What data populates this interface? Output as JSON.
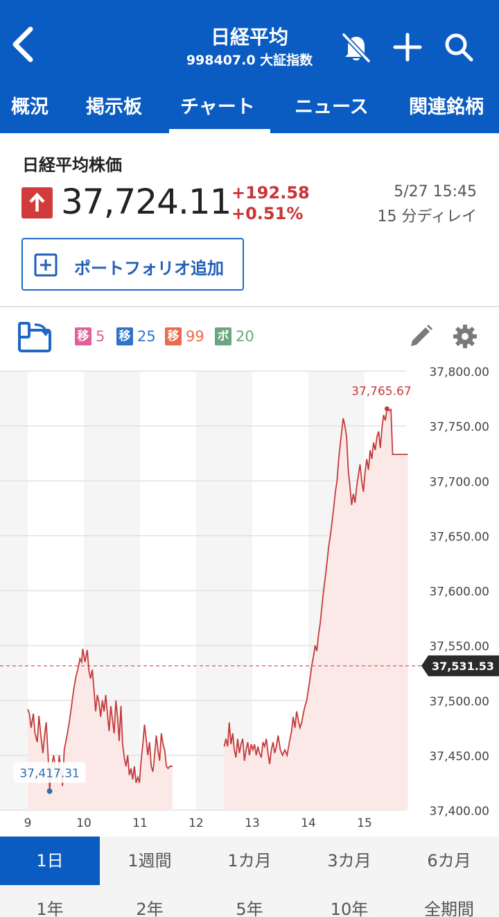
{
  "header": {
    "title": "日経平均",
    "subtitle": "998407.0 大証指数",
    "tabs": [
      "概況",
      "掲示板",
      "チャート",
      "ニュース",
      "関連銘柄"
    ],
    "active_tab": "チャート"
  },
  "quote": {
    "name": "日経平均株価",
    "price": "37,724.11",
    "change": "+192.58",
    "change_pct": "+0.51%",
    "datetime": "5/27 15:45",
    "delay": "15 分ディレイ",
    "portfolio_button": "ポートフォリオ追加"
  },
  "indicators": [
    {
      "badge": "移",
      "value": "5",
      "color": "#e2609a"
    },
    {
      "badge": "移",
      "value": "25",
      "color": "#2f74c8"
    },
    {
      "badge": "移",
      "value": "99",
      "color": "#ec6a4c"
    },
    {
      "badge": "ボ",
      "value": "20",
      "color": "#6aa680"
    }
  ],
  "chart_data": {
    "type": "line",
    "x_ticks": [
      "9",
      "10",
      "11",
      "12",
      "13",
      "14",
      "15"
    ],
    "y_ticks": [
      "37,800.00",
      "37,750.00",
      "37,700.00",
      "37,650.00",
      "37,600.00",
      "37,550.00",
      "37,500.00",
      "37,450.00",
      "37,400.00"
    ],
    "ylim": [
      37400,
      37800
    ],
    "xlim": [
      9,
      16
    ],
    "prev_close": 37531.53,
    "prev_close_label": "37,531.53",
    "high_label": "37,765.67",
    "low_label": "37,417.31",
    "high": {
      "x": 15.4,
      "y": 37765.67
    },
    "low": {
      "x": 9.39,
      "y": 37417.31
    },
    "colors": {
      "line": "#c43a3a",
      "fill": "#fbe9e8",
      "prev": "#e07070",
      "low": "#2a6fb0"
    },
    "morning": [
      [
        9.0,
        37492
      ],
      [
        9.03,
        37488
      ],
      [
        9.06,
        37475
      ],
      [
        9.1,
        37488
      ],
      [
        9.13,
        37470
      ],
      [
        9.17,
        37462
      ],
      [
        9.2,
        37486
      ],
      [
        9.23,
        37470
      ],
      [
        9.27,
        37452
      ],
      [
        9.3,
        37468
      ],
      [
        9.33,
        37480
      ],
      [
        9.36,
        37452
      ],
      [
        9.38,
        37432
      ],
      [
        9.39,
        37417.31
      ],
      [
        9.42,
        37438
      ],
      [
        9.46,
        37450
      ],
      [
        9.5,
        37438
      ],
      [
        9.53,
        37428
      ],
      [
        9.56,
        37450
      ],
      [
        9.59,
        37438
      ],
      [
        9.62,
        37422
      ],
      [
        9.65,
        37455
      ],
      [
        9.7,
        37468
      ],
      [
        9.74,
        37480
      ],
      [
        9.78,
        37495
      ],
      [
        9.82,
        37510
      ],
      [
        9.86,
        37522
      ],
      [
        9.9,
        37530
      ],
      [
        9.93,
        37538
      ],
      [
        9.96,
        37535
      ],
      [
        9.98,
        37547
      ],
      [
        10.02,
        37535
      ],
      [
        10.06,
        37546
      ],
      [
        10.09,
        37527
      ],
      [
        10.12,
        37520
      ],
      [
        10.15,
        37528
      ],
      [
        10.18,
        37510
      ],
      [
        10.21,
        37490
      ],
      [
        10.24,
        37505
      ],
      [
        10.27,
        37498
      ],
      [
        10.3,
        37485
      ],
      [
        10.33,
        37500
      ],
      [
        10.36,
        37490
      ],
      [
        10.39,
        37505
      ],
      [
        10.42,
        37488
      ],
      [
        10.45,
        37472
      ],
      [
        10.48,
        37495
      ],
      [
        10.51,
        37482
      ],
      [
        10.54,
        37470
      ],
      [
        10.57,
        37500
      ],
      [
        10.6,
        37485
      ],
      [
        10.63,
        37463
      ],
      [
        10.66,
        37495
      ],
      [
        10.69,
        37460
      ],
      [
        10.72,
        37448
      ],
      [
        10.75,
        37440
      ],
      [
        10.78,
        37450
      ],
      [
        10.81,
        37432
      ],
      [
        10.84,
        37438
      ],
      [
        10.87,
        37428
      ],
      [
        10.9,
        37440
      ],
      [
        10.93,
        37425
      ],
      [
        10.96,
        37430
      ],
      [
        10.99,
        37425
      ],
      [
        11.02,
        37445
      ],
      [
        11.05,
        37460
      ],
      [
        11.08,
        37478
      ],
      [
        11.11,
        37465
      ],
      [
        11.14,
        37450
      ],
      [
        11.17,
        37462
      ],
      [
        11.2,
        37440
      ],
      [
        11.23,
        37435
      ],
      [
        11.26,
        37450
      ],
      [
        11.29,
        37468
      ],
      [
        11.32,
        37455
      ],
      [
        11.35,
        37445
      ],
      [
        11.38,
        37470
      ],
      [
        11.41,
        37460
      ],
      [
        11.44,
        37455
      ],
      [
        11.47,
        37440
      ],
      [
        11.5,
        37438
      ],
      [
        11.53,
        37440
      ],
      [
        11.58,
        37440
      ]
    ],
    "afternoon": [
      [
        12.5,
        37458
      ],
      [
        12.53,
        37465
      ],
      [
        12.56,
        37458
      ],
      [
        12.59,
        37480
      ],
      [
        12.62,
        37460
      ],
      [
        12.65,
        37470
      ],
      [
        12.68,
        37455
      ],
      [
        12.71,
        37448
      ],
      [
        12.74,
        37465
      ],
      [
        12.77,
        37452
      ],
      [
        12.8,
        37460
      ],
      [
        12.83,
        37465
      ],
      [
        12.86,
        37445
      ],
      [
        12.89,
        37455
      ],
      [
        12.92,
        37462
      ],
      [
        12.95,
        37450
      ],
      [
        12.98,
        37460
      ],
      [
        13.01,
        37455
      ],
      [
        13.04,
        37460
      ],
      [
        13.07,
        37450
      ],
      [
        13.1,
        37458
      ],
      [
        13.13,
        37452
      ],
      [
        13.16,
        37448
      ],
      [
        13.19,
        37462
      ],
      [
        13.22,
        37458
      ],
      [
        13.25,
        37465
      ],
      [
        13.28,
        37452
      ],
      [
        13.31,
        37442
      ],
      [
        13.34,
        37455
      ],
      [
        13.37,
        37462
      ],
      [
        13.4,
        37452
      ],
      [
        13.43,
        37458
      ],
      [
        13.46,
        37468
      ],
      [
        13.5,
        37455
      ],
      [
        13.54,
        37450
      ],
      [
        13.58,
        37455
      ],
      [
        13.62,
        37450
      ],
      [
        13.66,
        37462
      ],
      [
        13.7,
        37472
      ],
      [
        13.73,
        37485
      ],
      [
        13.76,
        37475
      ],
      [
        13.79,
        37490
      ],
      [
        13.82,
        37482
      ],
      [
        13.85,
        37475
      ],
      [
        13.88,
        37480
      ],
      [
        13.91,
        37488
      ],
      [
        13.94,
        37495
      ],
      [
        13.97,
        37500
      ],
      [
        14.0,
        37510
      ],
      [
        14.03,
        37520
      ],
      [
        14.06,
        37532
      ],
      [
        14.09,
        37540
      ],
      [
        14.12,
        37550
      ],
      [
        14.15,
        37545
      ],
      [
        14.18,
        37560
      ],
      [
        14.21,
        37570
      ],
      [
        14.24,
        37585
      ],
      [
        14.27,
        37600
      ],
      [
        14.3,
        37612
      ],
      [
        14.33,
        37625
      ],
      [
        14.36,
        37640
      ],
      [
        14.39,
        37650
      ],
      [
        14.42,
        37662
      ],
      [
        14.45,
        37675
      ],
      [
        14.48,
        37690
      ],
      [
        14.51,
        37700
      ],
      [
        14.54,
        37720
      ],
      [
        14.57,
        37735
      ],
      [
        14.6,
        37748
      ],
      [
        14.62,
        37757
      ],
      [
        14.65,
        37750
      ],
      [
        14.68,
        37740
      ],
      [
        14.71,
        37710
      ],
      [
        14.74,
        37695
      ],
      [
        14.77,
        37678
      ],
      [
        14.8,
        37688
      ],
      [
        14.83,
        37680
      ],
      [
        14.86,
        37695
      ],
      [
        14.89,
        37705
      ],
      [
        14.92,
        37715
      ],
      [
        14.95,
        37700
      ],
      [
        14.98,
        37690
      ],
      [
        15.01,
        37708
      ],
      [
        15.04,
        37720
      ],
      [
        15.07,
        37710
      ],
      [
        15.1,
        37728
      ],
      [
        15.13,
        37720
      ],
      [
        15.16,
        37735
      ],
      [
        15.19,
        37728
      ],
      [
        15.22,
        37740
      ],
      [
        15.25,
        37745
      ],
      [
        15.28,
        37730
      ],
      [
        15.31,
        37748
      ],
      [
        15.34,
        37760
      ],
      [
        15.37,
        37755
      ],
      [
        15.4,
        37765.67
      ],
      [
        15.44,
        37764
      ],
      [
        15.47,
        37765
      ],
      [
        15.5,
        37724.11
      ],
      [
        15.77,
        37724.11
      ]
    ]
  },
  "periods": {
    "row1": [
      "1日",
      "1週間",
      "1カ月",
      "3カ月",
      "6カ月"
    ],
    "row2": [
      "1年",
      "2年",
      "5年",
      "10年",
      "全期間"
    ],
    "active": "1日"
  }
}
